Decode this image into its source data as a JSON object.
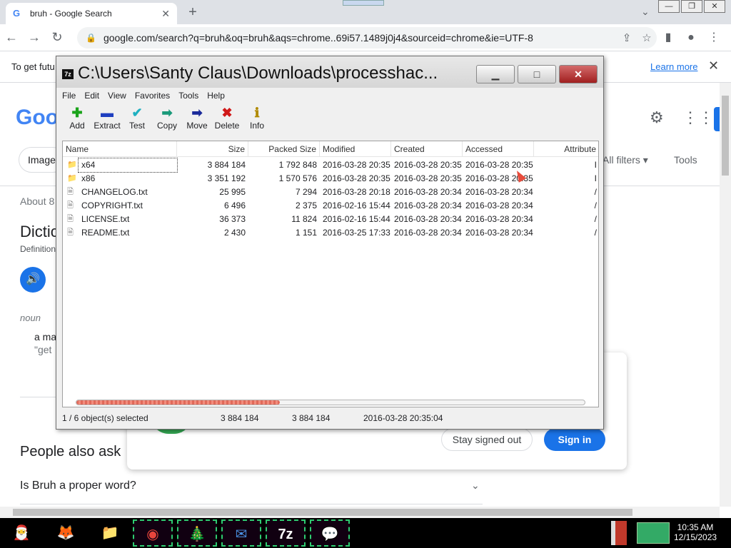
{
  "browser": {
    "tab_title": "bruh - Google Search",
    "tab_favicon": "G",
    "url": "google.com/search?q=bruh&oq=bruh&aqs=chrome..69i57.1489j0j4&sourceid=chrome&ie=UTF-8"
  },
  "infobar": {
    "message": "To get futu",
    "learn_more": "Learn more"
  },
  "google": {
    "logo": "Goo",
    "chip_images": "Image",
    "all_filters": "All filters",
    "tools": "Tools",
    "about": "About 8",
    "dictionary": "Dictic",
    "definitions": "Definition",
    "noun": "noun",
    "def_text": "a ma",
    "example": "\"get",
    "people_also_ask": "People also ask",
    "paa_question": "Is Bruh a proper word?",
    "stay_signed_out": "Stay signed out",
    "sign_in": "Sign in"
  },
  "sevenzip": {
    "title": "C:\\Users\\Santy Claus\\Downloads\\processhac...",
    "menu": [
      "File",
      "Edit",
      "View",
      "Favorites",
      "Tools",
      "Help"
    ],
    "toolbar": [
      {
        "label": "Add",
        "icon": "plus-icon",
        "glyph": "✚",
        "color": "#1aa31a"
      },
      {
        "label": "Extract",
        "icon": "minus-icon",
        "glyph": "▬",
        "color": "#1f3fc0"
      },
      {
        "label": "Test",
        "icon": "check-icon",
        "glyph": "✔",
        "color": "#1fb0c0"
      },
      {
        "label": "Copy",
        "icon": "arrow-right-icon",
        "glyph": "➡",
        "color": "#1a9a7a"
      },
      {
        "label": "Move",
        "icon": "arrow-right-icon",
        "glyph": "➡",
        "color": "#1a2a9a"
      },
      {
        "label": "Delete",
        "icon": "x-icon",
        "glyph": "✖",
        "color": "#d01818"
      },
      {
        "label": "Info",
        "icon": "info-icon",
        "glyph": "ℹ",
        "color": "#b08a00"
      }
    ],
    "columns": [
      "Name",
      "Size",
      "Packed Size",
      "Modified",
      "Created",
      "Accessed",
      "Attribute"
    ],
    "rows": [
      {
        "type": "folder",
        "name": "x64",
        "size": "3 884 184",
        "packed": "1 792 848",
        "modified": "2016-03-28 20:35",
        "created": "2016-03-28 20:35",
        "accessed": "2016-03-28 20:35",
        "attr": "I"
      },
      {
        "type": "folder",
        "name": "x86",
        "size": "3 351 192",
        "packed": "1 570 576",
        "modified": "2016-03-28 20:35",
        "created": "2016-03-28 20:35",
        "accessed": "2016-03-28 20:35",
        "attr": "I"
      },
      {
        "type": "file",
        "name": "CHANGELOG.txt",
        "size": "25 995",
        "packed": "7 294",
        "modified": "2016-03-28 20:18",
        "created": "2016-03-28 20:34",
        "accessed": "2016-03-28 20:34",
        "attr": "/"
      },
      {
        "type": "file",
        "name": "COPYRIGHT.txt",
        "size": "6 496",
        "packed": "2 375",
        "modified": "2016-02-16 15:44",
        "created": "2016-03-28 20:34",
        "accessed": "2016-03-28 20:34",
        "attr": "/"
      },
      {
        "type": "file",
        "name": "LICENSE.txt",
        "size": "36 373",
        "packed": "11 824",
        "modified": "2016-02-16 15:44",
        "created": "2016-03-28 20:34",
        "accessed": "2016-03-28 20:34",
        "attr": "/"
      },
      {
        "type": "file",
        "name": "README.txt",
        "size": "2 430",
        "packed": "1 151",
        "modified": "2016-03-25 17:33",
        "created": "2016-03-28 20:34",
        "accessed": "2016-03-28 20:34",
        "attr": "/"
      }
    ],
    "progress_fraction": 0.4,
    "status": {
      "selection": "1 / 6 object(s) selected",
      "size": "3 884 184",
      "packed": "3 884 184",
      "modified": "2016-03-28 20:35:04"
    }
  },
  "taskbar": {
    "time": "10:35 AM",
    "date": "12/15/2023",
    "apps": [
      {
        "name": "santa-icon",
        "glyph": "🎅"
      },
      {
        "name": "firefox-icon",
        "glyph": "🦊"
      },
      {
        "name": "file-explorer-icon",
        "glyph": "📁"
      },
      {
        "name": "chrome-icon",
        "glyph": "◉"
      },
      {
        "name": "christmas-tree-icon",
        "glyph": "🎄"
      },
      {
        "name": "mail-icon",
        "glyph": "✉"
      },
      {
        "name": "seven-zip-icon",
        "glyph": "7z"
      },
      {
        "name": "chat-icon",
        "glyph": "💬"
      }
    ]
  }
}
